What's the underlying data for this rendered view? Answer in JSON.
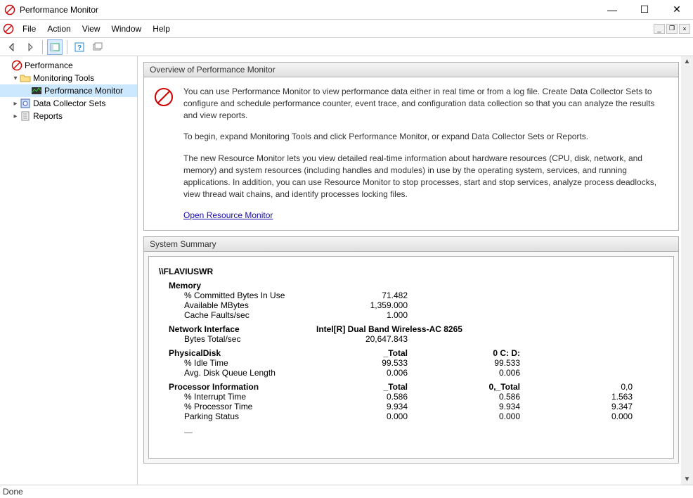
{
  "window": {
    "title": "Performance Monitor"
  },
  "menu": {
    "file": "File",
    "action": "Action",
    "view": "View",
    "window": "Window",
    "help": "Help"
  },
  "tree": {
    "root": "Performance",
    "monitoring_tools": "Monitoring Tools",
    "perfmon": "Performance Monitor",
    "data_collector": "Data Collector Sets",
    "reports": "Reports"
  },
  "overview": {
    "header": "Overview of Performance Monitor",
    "p1": "You can use Performance Monitor to view performance data either in real time or from a log file. Create Data Collector Sets to configure and schedule performance counter, event trace, and configuration data collection so that you can analyze the results and view reports.",
    "p2": "To begin, expand Monitoring Tools and click Performance Monitor, or expand Data Collector Sets or Reports.",
    "p3": "The new Resource Monitor lets you view detailed real-time information about hardware resources (CPU, disk, network, and memory) and system resources (including handles and modules) in use by the operating system, services, and running applications. In addition, you can use Resource Monitor to stop processes, start and stop services, analyze process deadlocks, view thread wait chains, and identify processes locking files.",
    "link": "Open Resource Monitor"
  },
  "summary": {
    "header": "System Summary",
    "host": "\\\\FLAVIUSWR",
    "memory": {
      "label": "Memory",
      "committed": {
        "label": "% Committed Bytes In Use",
        "value": "71.482"
      },
      "available": {
        "label": "Available MBytes",
        "value": "1,359.000"
      },
      "cache": {
        "label": "Cache Faults/sec",
        "value": "1.000"
      }
    },
    "network": {
      "label": "Network Interface",
      "adapter": "Intel[R] Dual Band Wireless-AC 8265",
      "bytes": {
        "label": "Bytes Total/sec",
        "value": "20,647.843"
      }
    },
    "disk": {
      "label": "PhysicalDisk",
      "col_total": "_Total",
      "col_0": "0 C: D:",
      "idle": {
        "label": "% Idle Time",
        "total": "99.533",
        "c0": "99.533"
      },
      "queue": {
        "label": "Avg. Disk Queue Length",
        "total": "0.006",
        "c0": "0.006"
      }
    },
    "proc": {
      "label": "Processor Information",
      "col_total": "_Total",
      "col_0t": "0,_Total",
      "col_00": "0,0",
      "interrupt": {
        "label": "% Interrupt Time",
        "total": "0.586",
        "c0t": "0.586",
        "c00": "1.563"
      },
      "ptime": {
        "label": "% Processor Time",
        "total": "9.934",
        "c0t": "9.934",
        "c00": "9.347"
      },
      "parking": {
        "label": "Parking Status",
        "total": "0.000",
        "c0t": "0.000",
        "c00": "0.000"
      }
    }
  },
  "status": {
    "text": "Done"
  }
}
